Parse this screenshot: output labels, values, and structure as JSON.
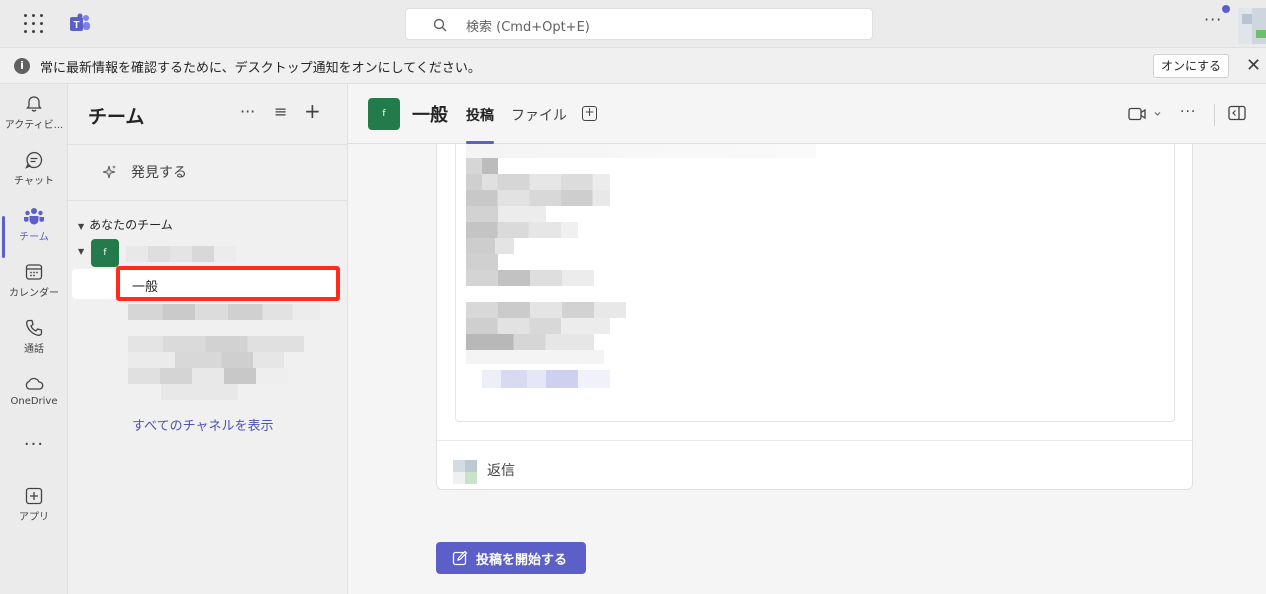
{
  "topbar": {
    "search_placeholder": "検索 (Cmd+Opt+E)",
    "more_label": "···"
  },
  "notification": {
    "message": "常に最新情報を確認するために、デスクトップ通知をオンにしてください。",
    "enable_button": "オンにする",
    "close_label": "✕"
  },
  "rail": {
    "items": [
      {
        "label": "アクティビ...",
        "icon": "bell-icon"
      },
      {
        "label": "チャット",
        "icon": "chat-icon"
      },
      {
        "label": "チーム",
        "icon": "teams-icon",
        "active": true
      },
      {
        "label": "カレンダー",
        "icon": "calendar-icon"
      },
      {
        "label": "通話",
        "icon": "phone-icon"
      },
      {
        "label": "OneDrive",
        "icon": "cloud-icon"
      },
      {
        "label": "アプリ",
        "icon": "add-app-icon"
      }
    ],
    "more_label": "···"
  },
  "panel": {
    "title": "チーム",
    "more": "···",
    "filter": "≡",
    "add": "+",
    "discover": "発見する",
    "section": "あなたのチーム",
    "team_initial": "f",
    "selected_channel": "一般",
    "see_all": "すべてのチャネルを表示"
  },
  "channel": {
    "initial": "f",
    "name": "一般",
    "tabs": [
      "投稿",
      "ファイル"
    ],
    "add_tab": "+",
    "more": "···"
  },
  "post": {
    "reply_label": "返信"
  },
  "start_post_button": "投稿を開始する",
  "colors": {
    "brand": "#5b5fc7",
    "team_avatar": "#237b4b",
    "highlight": "#ff2b1c"
  }
}
